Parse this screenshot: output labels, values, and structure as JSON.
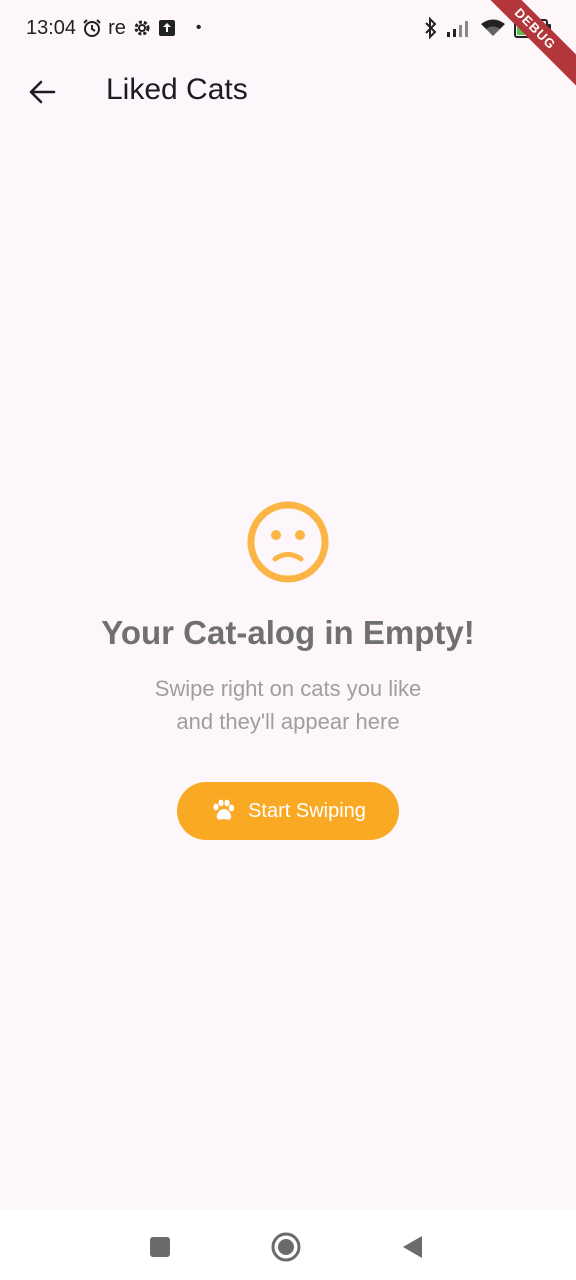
{
  "status_bar": {
    "time": "13:04",
    "carrier": "re",
    "battery": "87",
    "debug_label": "DEBUG"
  },
  "app_bar": {
    "title": "Liked Cats",
    "back_icon": "arrow-left-icon"
  },
  "empty_state": {
    "icon": "sad-face-icon",
    "title": "Your Cat-alog in Empty!",
    "subtitle_line1": "Swipe right on cats you like",
    "subtitle_line2": "and they'll appear here",
    "button_label": "Start Swiping",
    "button_icon": "paw-icon"
  },
  "nav_bar": {
    "icons": [
      "recents-icon",
      "home-icon",
      "back-icon"
    ]
  },
  "colors": {
    "background": "#fdf7fc",
    "accent": "#faa925",
    "title_gray": "#707070",
    "subtitle_gray": "#9e9e9e"
  }
}
